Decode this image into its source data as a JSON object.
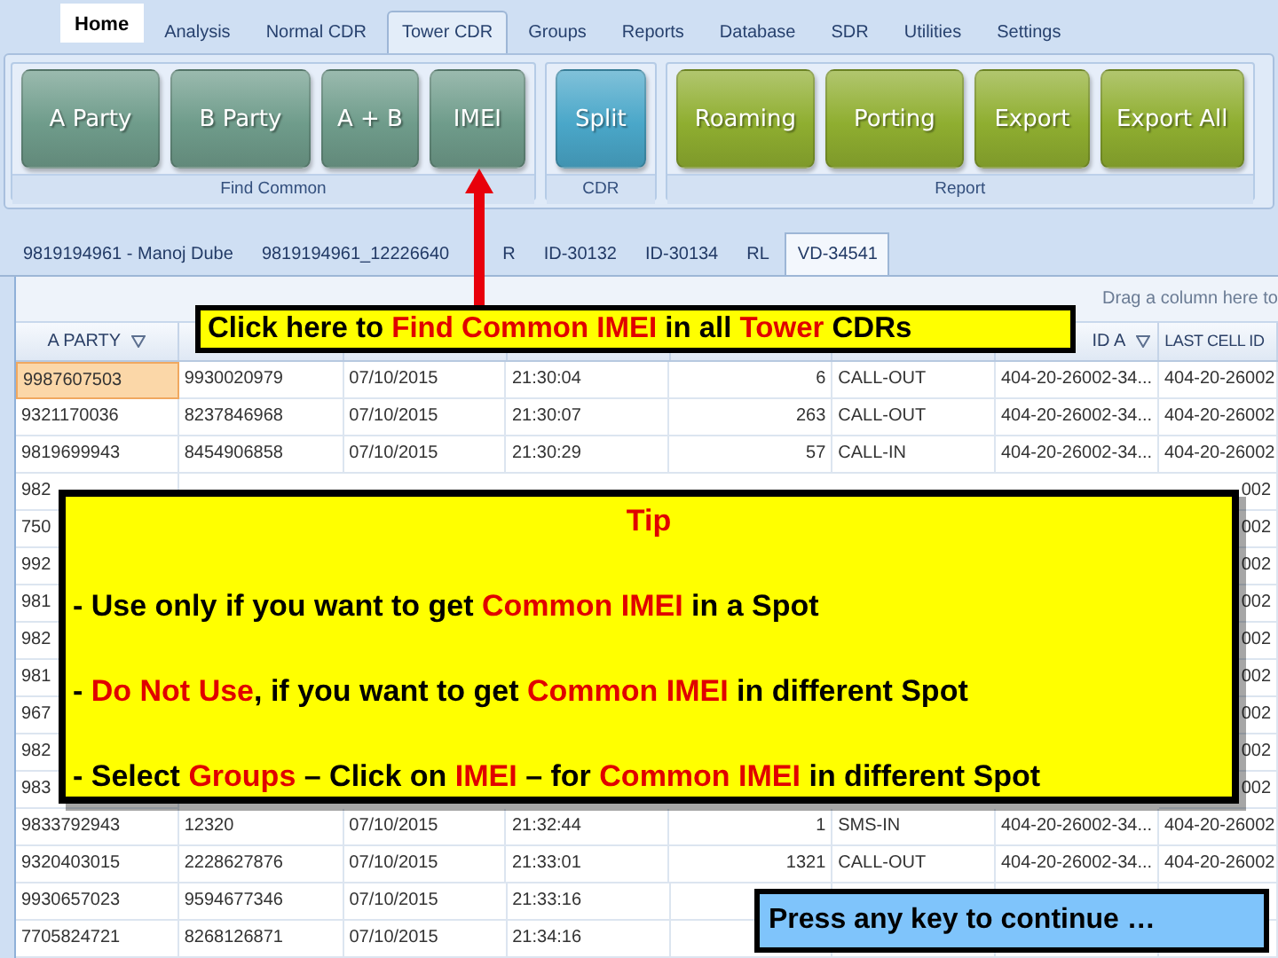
{
  "ribbon_tabs": [
    {
      "label": "Home",
      "selected": false,
      "highlighted": true
    },
    {
      "label": "Analysis",
      "selected": false,
      "highlighted": false
    },
    {
      "label": "Normal CDR",
      "selected": false,
      "highlighted": false
    },
    {
      "label": "Tower CDR",
      "selected": true,
      "highlighted": false
    },
    {
      "label": "Groups",
      "selected": false,
      "highlighted": false
    },
    {
      "label": "Reports",
      "selected": false,
      "highlighted": false
    },
    {
      "label": "Database",
      "selected": false,
      "highlighted": false
    },
    {
      "label": "SDR",
      "selected": false,
      "highlighted": false
    },
    {
      "label": "Utilities",
      "selected": false,
      "highlighted": false
    },
    {
      "label": "Settings",
      "selected": false,
      "highlighted": false
    }
  ],
  "ribbon_groups": [
    {
      "label": "Find Common",
      "color": "#6f9c8b",
      "buttons": [
        "A Party",
        "B Party",
        "A + B",
        "IMEI"
      ]
    },
    {
      "label": "CDR",
      "color": "#4aa7c9",
      "buttons": [
        "Split"
      ]
    },
    {
      "label": "Report",
      "color": "#8fae30",
      "buttons": [
        "Roaming",
        "Porting",
        "Export",
        "Export All"
      ]
    }
  ],
  "document_tabs": [
    {
      "label": "9819194961 - Manoj Dube",
      "selected": false
    },
    {
      "label": "9819194961_12226640",
      "selected": false
    },
    {
      "label": "R",
      "selected": false
    },
    {
      "label": "ID-30132",
      "selected": false
    },
    {
      "label": "ID-30134",
      "selected": false
    },
    {
      "label": "RL",
      "selected": false
    },
    {
      "label": "VD-34541",
      "selected": true
    }
  ],
  "grid": {
    "group_hint": "Drag a column here to",
    "columns": [
      {
        "label": "A PARTY",
        "filter": true
      },
      {},
      {},
      {},
      {},
      {},
      {
        "label": "ID A",
        "filter": true
      },
      {
        "label": "LAST CELL ID"
      }
    ],
    "rows": [
      {
        "selected": true,
        "column_1": "9987607503",
        "column_2": "9930020979",
        "column_3": "07/10/2015",
        "column_4": "21:30:04",
        "column_5": "6",
        "column_6": "CALL-OUT",
        "column_7": "404-20-26002-34...",
        "column_8": "404-20-26002"
      },
      {
        "selected": false,
        "column_1": "9321170036",
        "column_2": "8237846968",
        "column_3": "07/10/2015",
        "column_4": "21:30:07",
        "column_5": "263",
        "column_6": "CALL-OUT",
        "column_7": "404-20-26002-34...",
        "column_8": "404-20-26002"
      },
      {
        "selected": false,
        "column_1": "9819699943",
        "column_2": "8454906858",
        "column_3": "07/10/2015",
        "column_4": "21:30:29",
        "column_5": "57",
        "column_6": "CALL-IN",
        "column_7": "404-20-26002-34...",
        "column_8": "404-20-26002"
      },
      {
        "selected": false,
        "column_1": "982",
        "column_8": "002"
      },
      {
        "selected": false,
        "column_1": "750",
        "column_8": "002"
      },
      {
        "selected": false,
        "column_1": "992",
        "column_8": "002"
      },
      {
        "selected": false,
        "column_1": "981",
        "column_8": "002"
      },
      {
        "selected": false,
        "column_1": "982",
        "column_8": "002"
      },
      {
        "selected": false,
        "column_1": "981",
        "column_8": "002"
      },
      {
        "selected": false,
        "column_1": "967",
        "column_8": "002"
      },
      {
        "selected": false,
        "column_1": "982",
        "column_8": "002"
      },
      {
        "selected": false,
        "column_1": "983",
        "column_8": "002"
      },
      {
        "selected": false,
        "column_1": "9833792943",
        "column_2": "12320",
        "column_3": "07/10/2015",
        "column_4": "21:32:44",
        "column_5": "1",
        "column_6": "SMS-IN",
        "column_7": "404-20-26002-34...",
        "column_8": "404-20-26002"
      },
      {
        "selected": false,
        "column_1": "9320403015",
        "column_2": "2228627876",
        "column_3": "07/10/2015",
        "column_4": "21:33:01",
        "column_5": "1321",
        "column_6": "CALL-OUT",
        "column_7": "404-20-26002-34...",
        "column_8": "404-20-26002"
      },
      {
        "selected": false,
        "column_1": "9930657023",
        "column_2": "9594677346",
        "column_3": "07/10/2015",
        "column_4": "21:33:16"
      },
      {
        "selected": false,
        "column_1": "7705824721",
        "column_2": "8268126871",
        "column_3": "07/10/2015",
        "column_4": "21:34:16"
      }
    ]
  },
  "callout": {
    "text": "Click here to **Find Common IMEI** in all **Tower** CDRs"
  },
  "tip": {
    "title": "Tip",
    "lines": [
      "- Use only if you want to get **Common IMEI** in a Spot",
      "- **Do Not Use**, if you want to get **Common IMEI** in different Spot",
      "- Select **Groups** – Click on **IMEI** – for **Common IMEI** in different Spot"
    ]
  },
  "continue_prompt": "Press any key to continue …"
}
